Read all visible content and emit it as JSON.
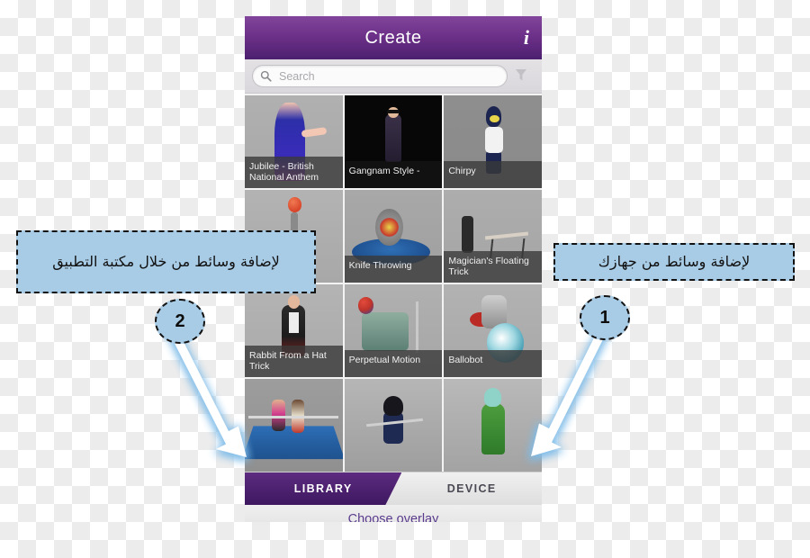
{
  "app": {
    "header": {
      "title": "Create",
      "info_icon": "info-icon"
    },
    "search": {
      "placeholder": "Search",
      "value": "",
      "search_icon": "search-icon",
      "filter_icon": "filter-funnel-icon"
    },
    "grid": {
      "tiles": [
        {
          "label": "Jubilee - British National Anthem",
          "art": "a-jubilee",
          "dark": false
        },
        {
          "label": "Gangnam Style -",
          "art": "a-gangnam",
          "dark": true
        },
        {
          "label": "Chirpy",
          "art": "a-chirpy",
          "dark": false
        },
        {
          "label": "",
          "art": "a-knife-top",
          "dark": false
        },
        {
          "label": "Knife Throwing",
          "art": "a-knife",
          "dark": false
        },
        {
          "label": "Magician's Floating Trick",
          "art": "a-magician",
          "dark": false
        },
        {
          "label": "Rabbit From a Hat Trick",
          "art": "a-rabbit",
          "dark": false
        },
        {
          "label": "Perpetual Motion",
          "art": "a-perpetual",
          "dark": false
        },
        {
          "label": "Ballobot",
          "art": "a-ballo",
          "dark": false
        },
        {
          "label": "",
          "art": "a-ring",
          "dark": false
        },
        {
          "label": "",
          "art": "a-ninja",
          "dark": false
        },
        {
          "label": "",
          "art": "a-green",
          "dark": false
        }
      ]
    },
    "tabs": [
      {
        "label": "LIBRARY",
        "active": true
      },
      {
        "label": "DEVICE",
        "active": false
      }
    ],
    "footer": {
      "caption": "Choose overlay",
      "dots": 4,
      "active_dot": 1
    }
  },
  "annotations": {
    "callout_left": {
      "text": "لإضافة وسائط من خلال مكتبة التطبيق",
      "badge": "2"
    },
    "callout_right": {
      "text": "لإضافة وسائط من جهازك",
      "badge": "1"
    }
  },
  "colors": {
    "header_purple": "#6d3189",
    "tab_active_purple": "#4a1d6e",
    "callout_blue": "#a9cce6",
    "caption_purple": "#5b3b8c",
    "arrow_glow": "#7fbce8"
  }
}
